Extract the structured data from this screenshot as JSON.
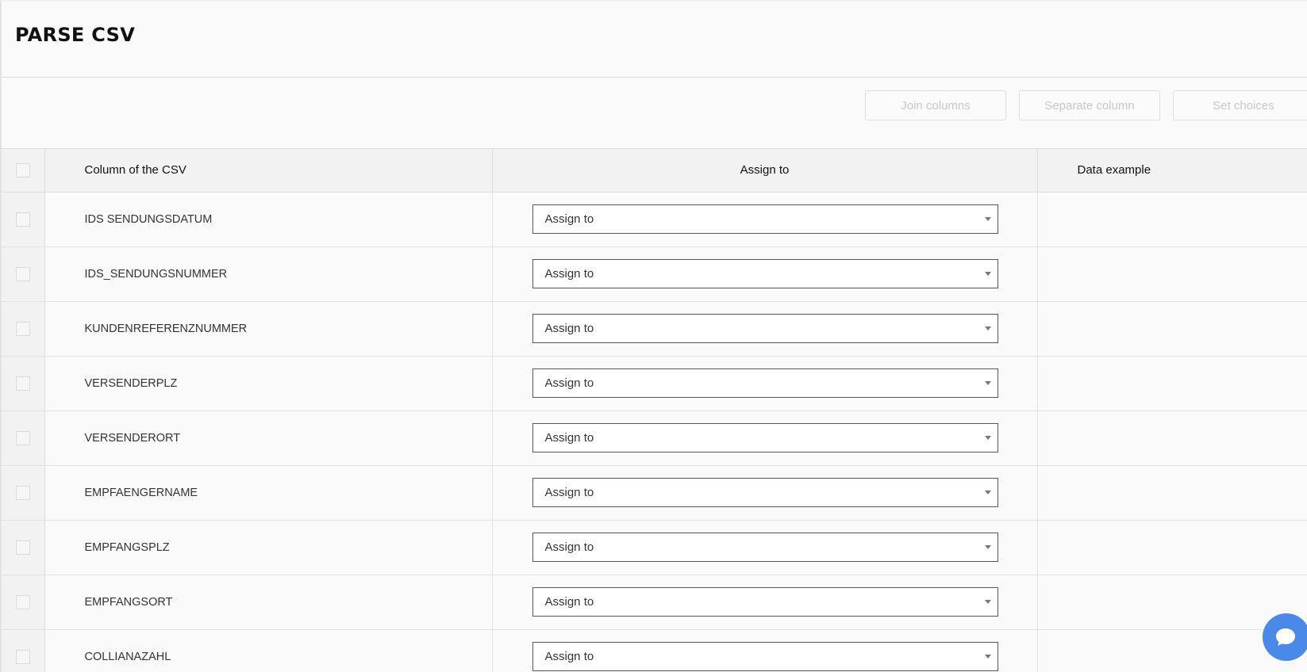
{
  "page": {
    "title": "PARSE CSV"
  },
  "toolbar": {
    "join_label": "Join columns",
    "separate_label": "Separate column",
    "choices_label": "Set choices"
  },
  "table": {
    "headers": {
      "column": "Column of the CSV",
      "assign": "Assign to",
      "data": "Data example"
    },
    "rows": [
      {
        "name": "IDS SENDUNGSDATUM",
        "assign": "Assign to",
        "data": ""
      },
      {
        "name": "IDS_SENDUNGSNUMMER",
        "assign": "Assign to",
        "data": ""
      },
      {
        "name": "KUNDENREFERENZNUMMER",
        "assign": "Assign to",
        "data": ""
      },
      {
        "name": "VERSENDERPLZ",
        "assign": "Assign to",
        "data": ""
      },
      {
        "name": "VERSENDERORT",
        "assign": "Assign to",
        "data": ""
      },
      {
        "name": "EMPFAENGERNAME",
        "assign": "Assign to",
        "data": ""
      },
      {
        "name": "EMPFANGSPLZ",
        "assign": "Assign to",
        "data": ""
      },
      {
        "name": "EMPFANGSORT",
        "assign": "Assign to",
        "data": ""
      },
      {
        "name": "COLLIANAZAHL",
        "assign": "Assign to",
        "data": ""
      }
    ]
  },
  "chat": {
    "icon": "chat-icon",
    "color": "#4a89e8"
  },
  "colors": {
    "header_bg": "#f2f2f2",
    "disabled_text": "#c8c8c8",
    "accent": "#4a89e8"
  }
}
